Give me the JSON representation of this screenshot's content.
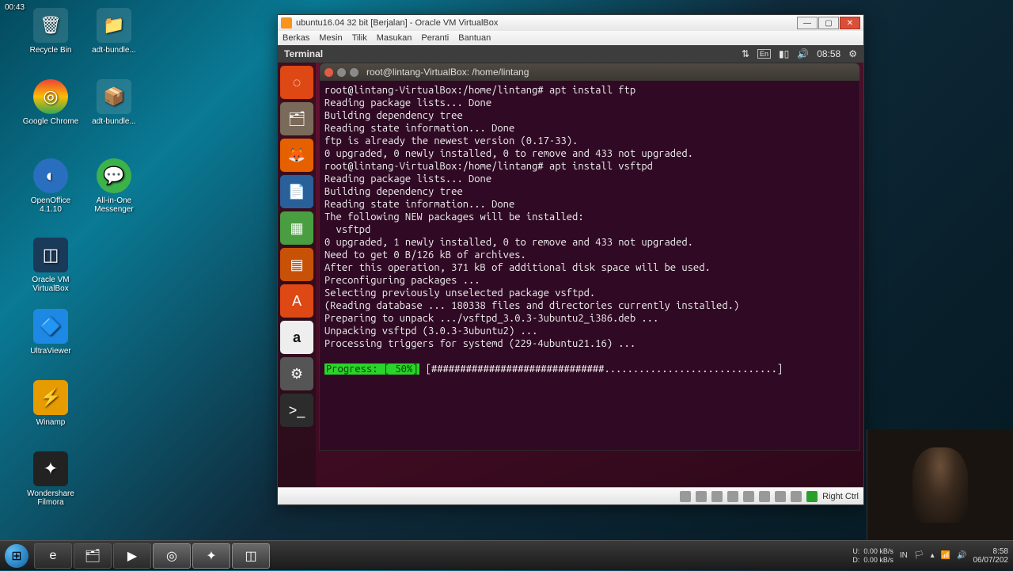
{
  "rec_time": "00:43",
  "desktop_icons": [
    {
      "label": "Recycle Bin",
      "glyph": "🗑"
    },
    {
      "label": "adt-bundle...",
      "glyph": "📁"
    },
    {
      "label": "Google Chrome",
      "glyph": "◎"
    },
    {
      "label": "adt-bundle...",
      "glyph": "📦"
    },
    {
      "label": "OpenOffice 4.1.10",
      "glyph": "◐"
    },
    {
      "label": "All-in-One Messenger",
      "glyph": "💬"
    },
    {
      "label": "Oracle VM VirtualBox",
      "glyph": "◫"
    },
    {
      "label": "UltraViewer",
      "glyph": "🔷"
    },
    {
      "label": "Winamp",
      "glyph": "⚡"
    },
    {
      "label": "Wondershare Filmora",
      "glyph": "✦"
    }
  ],
  "vbox": {
    "title": "ubuntu16.04 32 bit [Berjalan] - Oracle VM VirtualBox",
    "menu": [
      "Berkas",
      "Mesin",
      "Tilik",
      "Masukan",
      "Peranti",
      "Bantuan"
    ],
    "status_key": "Right Ctrl"
  },
  "ubuntu": {
    "topbar_title": "Terminal",
    "lang": "En",
    "time": "08:58"
  },
  "terminal": {
    "title": "root@lintang-VirtualBox: /home/lintang",
    "lines": [
      "root@lintang-VirtualBox:/home/lintang# apt install ftp",
      "Reading package lists... Done",
      "Building dependency tree",
      "Reading state information... Done",
      "ftp is already the newest version (0.17-33).",
      "0 upgraded, 0 newly installed, 0 to remove and 433 not upgraded.",
      "root@lintang-VirtualBox:/home/lintang# apt install vsftpd",
      "Reading package lists... Done",
      "Building dependency tree",
      "Reading state information... Done",
      "The following NEW packages will be installed:",
      "  vsftpd",
      "0 upgraded, 1 newly installed, 0 to remove and 433 not upgraded.",
      "Need to get 0 B/126 kB of archives.",
      "After this operation, 371 kB of additional disk space will be used.",
      "Preconfiguring packages ...",
      "Selecting previously unselected package vsftpd.",
      "(Reading database ... 180338 files and directories currently installed.)",
      "Preparing to unpack .../vsftpd_3.0.3-3ubuntu2_i386.deb ...",
      "Unpacking vsftpd (3.0.3-3ubuntu2) ...",
      "Processing triggers for systemd (229-4ubuntu21.16) ..."
    ],
    "progress_label": "Progress: [ 50%]",
    "progress_bar": "[##############################..............................]"
  },
  "taskbar": {
    "speed_u": "0.00 kB/s",
    "speed_d": "0.00 kB/s",
    "speed_u_lbl": "U:",
    "speed_d_lbl": "D:",
    "lang": "IN",
    "time": "8:58",
    "date": "06/07/202"
  }
}
